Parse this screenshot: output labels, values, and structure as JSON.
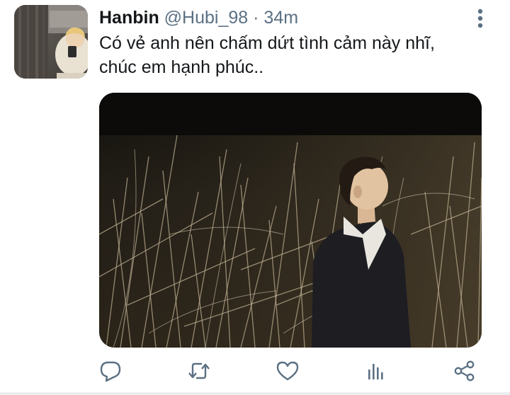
{
  "tweet": {
    "author_name": "Hanbin",
    "handle": "@Hubi_98",
    "separator": "·",
    "time": "34m",
    "text_line1": "Có vẻ anh nên chấm dứt tình cảm này nhĩ,",
    "text_line2": "chúc em hạnh phúc.."
  },
  "icons": {
    "more": "more-vertical-icon",
    "reply": "reply-icon",
    "retweet": "retweet-icon",
    "like": "heart-icon",
    "analytics": "analytics-icon",
    "share": "share-icon"
  },
  "colors": {
    "text": "#14171a",
    "secondary": "#5b7083",
    "icon": "#5b7083"
  }
}
